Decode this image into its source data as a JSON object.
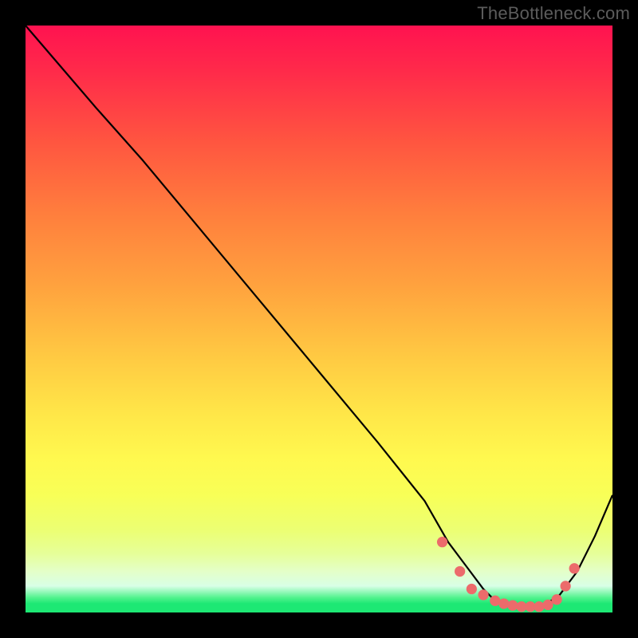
{
  "watermark": "TheBottleneck.com",
  "colors": {
    "background": "#000000",
    "gradient_top": "#ff1250",
    "gradient_mid": "#fff94f",
    "gradient_bottom": "#1de874",
    "curve": "#000000",
    "dots": "#ec6b6b"
  },
  "chart_data": {
    "type": "line",
    "title": "",
    "xlabel": "",
    "ylabel": "",
    "xlim": [
      0,
      100
    ],
    "ylim": [
      0,
      100
    ],
    "grid": false,
    "legend": false,
    "series": [
      {
        "name": "bottleneck-curve",
        "x": [
          0,
          6,
          12,
          20,
          30,
          40,
          50,
          60,
          68,
          72,
          75,
          78,
          80,
          83,
          86,
          88,
          91,
          94,
          97,
          100
        ],
        "y": [
          100,
          93,
          86,
          77,
          65,
          53,
          41,
          29,
          19,
          12,
          8,
          4,
          2,
          1,
          1,
          1,
          3,
          7,
          13,
          20
        ]
      }
    ],
    "points": {
      "name": "highlighted-points",
      "x": [
        71,
        74,
        76,
        78,
        80,
        81.5,
        83,
        84.5,
        86,
        87.5,
        89,
        90.5,
        92,
        93.5
      ],
      "y": [
        12,
        7,
        4,
        3,
        2,
        1.5,
        1.2,
        1,
        1,
        1,
        1.3,
        2.2,
        4.5,
        7.5
      ]
    }
  }
}
